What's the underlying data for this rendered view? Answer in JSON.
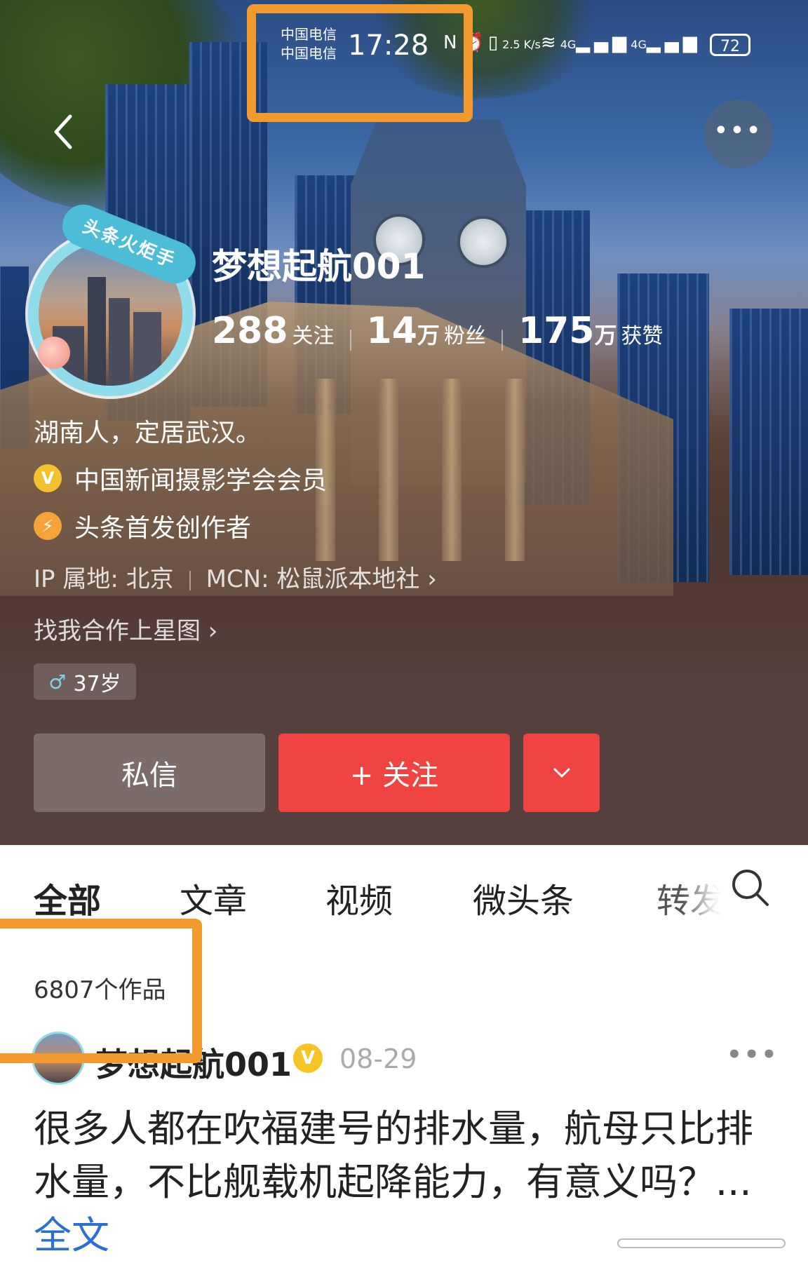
{
  "status_bar": {
    "carrier_1": "中国电信",
    "carrier_2": "中国电信",
    "time": "17:28",
    "net_speed": "2.5 K/s",
    "signal_1": "4G",
    "signal_2": "4G",
    "battery": "72"
  },
  "profile": {
    "badge": "头条火炬手",
    "name": "梦想起航001",
    "stats": [
      {
        "num": "288",
        "unit": "",
        "label": "关注"
      },
      {
        "num": "14",
        "unit": "万",
        "label": "粉丝"
      },
      {
        "num": "175",
        "unit": "万",
        "label": "获赞"
      }
    ],
    "bio": "湖南人，定居武汉。",
    "cert_1": "中国新闻摄影学会会员",
    "cert_2": "头条首发创作者",
    "ip": "IP 属地: 北京",
    "mcn": "MCN: 松鼠派本地社 ›",
    "star_link": "找我合作上星图 ›",
    "age": "37岁"
  },
  "buttons": {
    "message": "私信",
    "follow": "+ 关注",
    "dropdown": "⌄"
  },
  "tabs": [
    "全部",
    "文章",
    "视频",
    "微头条",
    "转发"
  ],
  "works_count": "6807个作品",
  "post": {
    "author": "梦想起航001",
    "date": "08-29",
    "text": "很多人都在吹福建号的排水量，航母只比排水量，不比舰载机起降能力，有意义吗？...",
    "read_more": "全文"
  },
  "colors": {
    "accent_red": "#f04443",
    "highlight_orange": "#f39a2e",
    "link_blue": "#2b6fd6"
  }
}
